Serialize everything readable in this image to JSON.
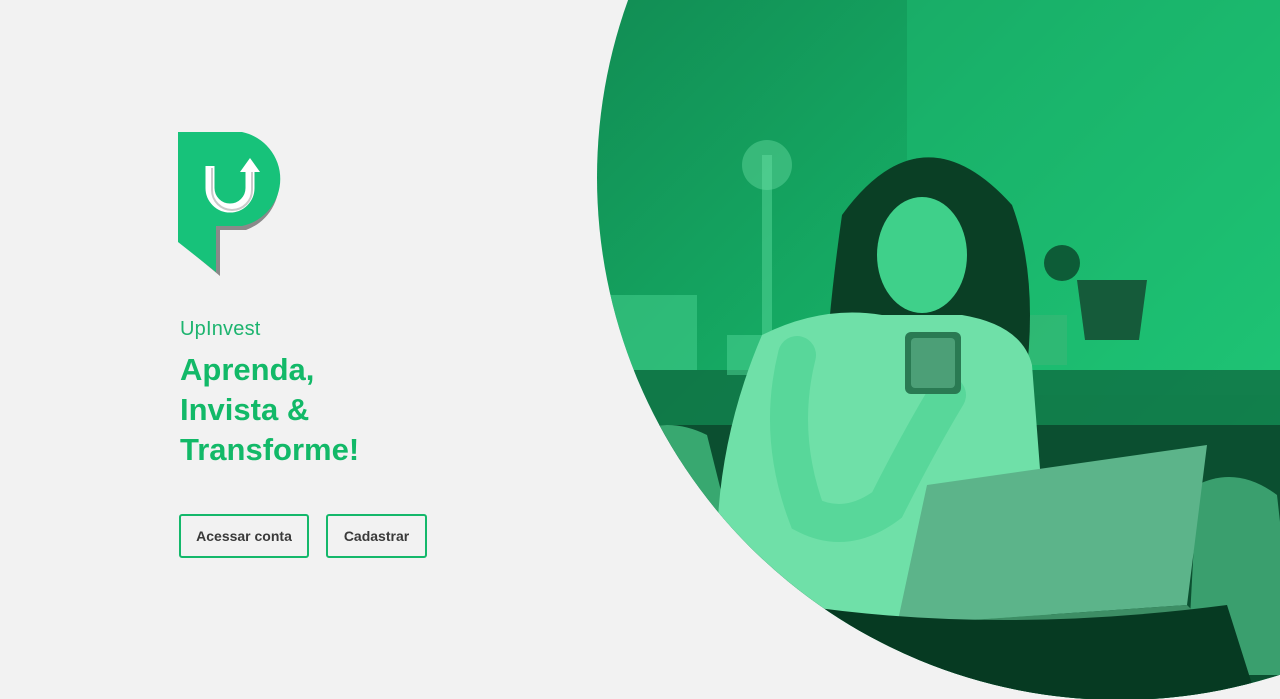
{
  "brand": {
    "name": "UpInvest",
    "logo_icon": "upinvest-logo-icon",
    "accent_color": "#12b968"
  },
  "hero": {
    "headline_line1": "Aprenda,",
    "headline_line2": "Invista &",
    "headline_line3": "Transforme!",
    "image": "woman-with-phone-and-laptop-image"
  },
  "actions": {
    "login_label": "Acessar conta",
    "signup_label": "Cadastrar"
  }
}
